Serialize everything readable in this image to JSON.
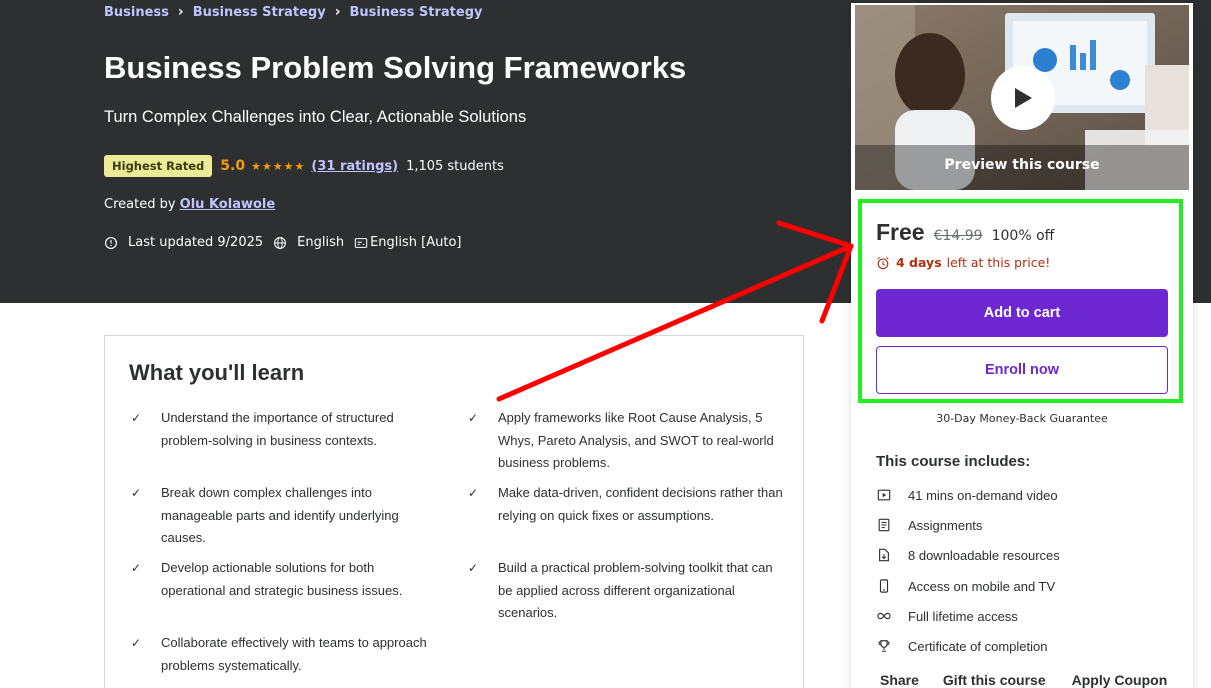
{
  "breadcrumb": [
    "Business",
    "Business Strategy",
    "Business Strategy"
  ],
  "course": {
    "title": "Business Problem Solving Frameworks",
    "subtitle": "Turn Complex Challenges into Clear, Actionable Solutions",
    "badge": "Highest Rated",
    "rating": "5.0",
    "stars": "★★★★★",
    "rating_count": "(31 ratings)",
    "students": "1,105 students",
    "created_by_label": "Created by",
    "author": "Olu Kolawole",
    "last_updated": "Last updated 9/2025",
    "language": "English",
    "captions": "English [Auto]"
  },
  "learn": {
    "title": "What you'll learn",
    "items": [
      "Understand the importance of structured problem-solving in business contexts.",
      "Apply frameworks like Root Cause Analysis, 5 Whys, Pareto Analysis, and SWOT to real-world business problems.",
      "Break down complex challenges into manageable parts and identify underlying causes.",
      "Make data-driven, confident decisions rather than relying on quick fixes or assumptions.",
      "Develop actionable solutions for both operational and strategic business issues.",
      "Build a practical problem-solving toolkit that can be applied across different organizational scenarios.",
      "Collaborate effectively with teams to approach problems systematically."
    ]
  },
  "sidebar": {
    "preview_label": "Preview this course",
    "price_now": "Free",
    "price_old": "€14.99",
    "discount": "100% off",
    "timer_days": "4 days",
    "timer_text": "left at this price!",
    "add_to_cart": "Add to cart",
    "enroll_now": "Enroll now",
    "guarantee": "30-Day Money-Back Guarantee",
    "includes_title": "This course includes:",
    "includes": [
      {
        "icon": "video-icon",
        "label": "41 mins on-demand video"
      },
      {
        "icon": "assignment-icon",
        "label": "Assignments"
      },
      {
        "icon": "download-icon",
        "label": "8 downloadable resources"
      },
      {
        "icon": "mobile-icon",
        "label": "Access on mobile and TV"
      },
      {
        "icon": "infinity-icon",
        "label": "Full lifetime access"
      },
      {
        "icon": "trophy-icon",
        "label": "Certificate of completion"
      }
    ],
    "footer": [
      "Share",
      "Gift this course",
      "Apply Coupon"
    ]
  },
  "colors": {
    "hero_bg": "#2d2f31",
    "accent": "#6d28d2",
    "link_light": "#c0c4fc",
    "star": "#f69c08",
    "highlight": "#22ee22",
    "arrow": "#ff0000"
  }
}
